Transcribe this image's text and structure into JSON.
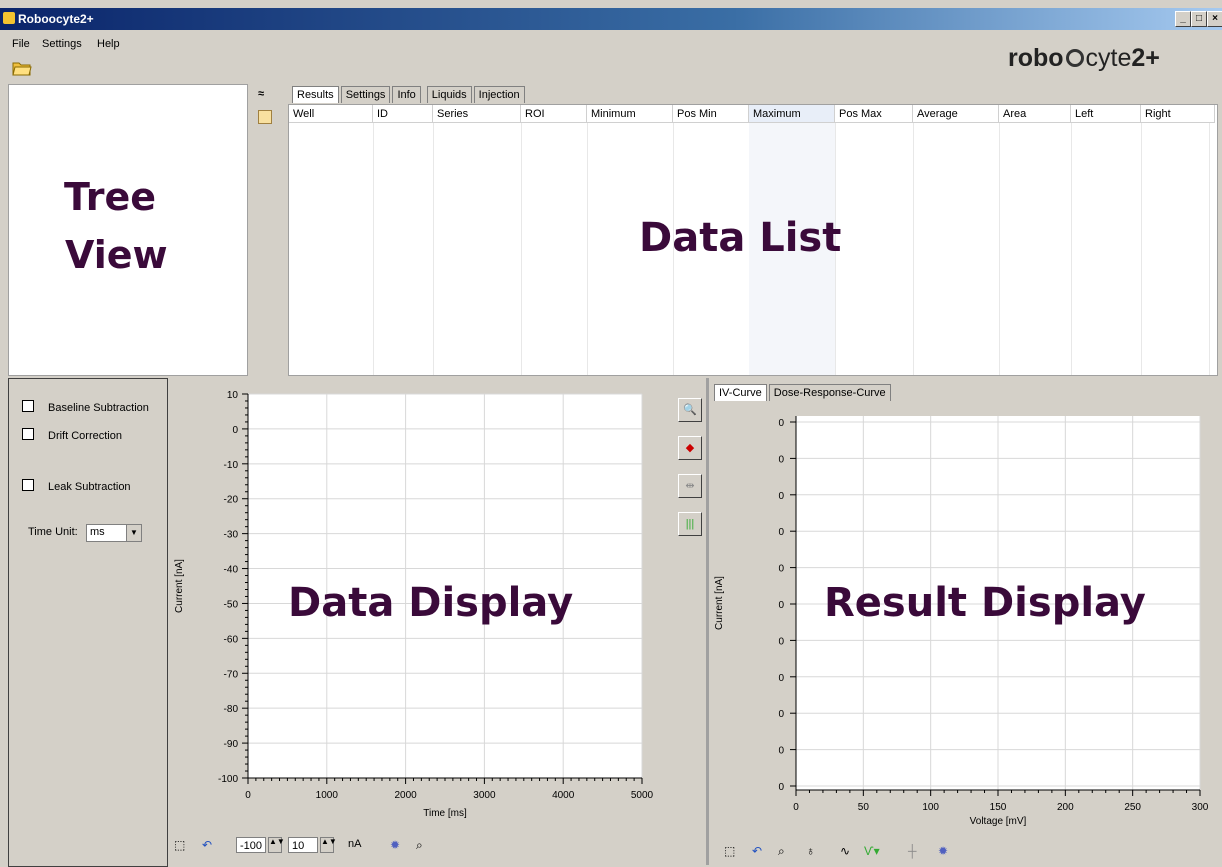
{
  "window": {
    "title": "Roboocyte2+",
    "min": "_",
    "max": "□",
    "close": "×"
  },
  "menu": {
    "file": "File",
    "settings": "Settings",
    "help": "Help"
  },
  "logo": {
    "robo": "robo",
    "cyte": "cyte",
    "suffix": "2+"
  },
  "tree_view": {
    "line1": "Tree",
    "line2": "View"
  },
  "data_tabs": [
    "Results",
    "Settings",
    "Info",
    "Liquids",
    "Injection"
  ],
  "data_list": {
    "columns": [
      "Well",
      "ID",
      "Series",
      "ROI",
      "Minimum",
      "Pos Min",
      "Maximum",
      "Pos Max",
      "Average",
      "Area",
      "Left",
      "Right"
    ],
    "overlay": "Data List"
  },
  "left_options": {
    "baseline": "Baseline Subtraction",
    "drift": "Drift Correction",
    "leak": "Leak Subtraction",
    "time_unit_label": "Time Unit:",
    "time_unit_value": "ms"
  },
  "data_display": {
    "overlay": "Data Display",
    "chart_data": {
      "type": "line",
      "xlabel": "Time [ms]",
      "ylabel": "Current [nA]",
      "xlim": [
        0,
        5000
      ],
      "ylim": [
        -100,
        10
      ],
      "xticks": [
        "0",
        "1000",
        "2000",
        "3000",
        "4000",
        "5000"
      ],
      "yticks": [
        "10",
        "0",
        "-10",
        "-20",
        "-30",
        "-40",
        "-50",
        "-60",
        "-70",
        "-80",
        "-90",
        "-100"
      ],
      "grid": true,
      "series": []
    },
    "toolbar": {
      "spin1": "-100",
      "spin2": "10",
      "unit": "nA"
    }
  },
  "result_tabs": [
    "IV-Curve",
    "Dose-Response-Curve"
  ],
  "result_display": {
    "overlay": "Result Display",
    "chart_data": {
      "type": "line",
      "xlabel": "Voltage [mV]",
      "ylabel": "Current [nA]",
      "xlim": [
        0,
        300
      ],
      "xticks": [
        "0",
        "50",
        "100",
        "150",
        "200",
        "250",
        "300"
      ],
      "yticks": [
        "0",
        "0",
        "0",
        "0",
        "0",
        "0",
        "0",
        "0",
        "0",
        "0",
        "0"
      ],
      "grid": true,
      "series": []
    }
  }
}
